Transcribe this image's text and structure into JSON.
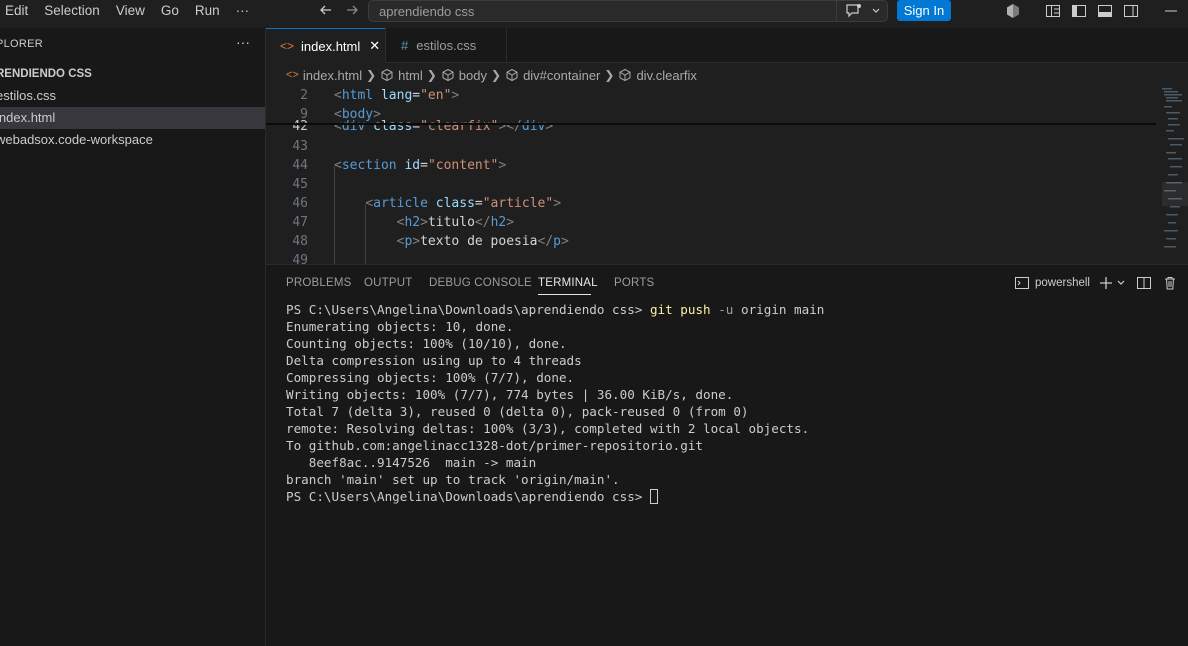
{
  "menu": [
    "Edit",
    "Selection",
    "View",
    "Go",
    "Run",
    "···"
  ],
  "search": {
    "text": "aprendiendo css"
  },
  "signin_label": "Sign In",
  "explorer": {
    "header": "PLORER",
    "more": "···",
    "folder": "RENDIENDO CSS",
    "files": [
      {
        "name": "estilos.css",
        "active": false
      },
      {
        "name": "index.html",
        "active": true
      },
      {
        "name": "webadsox.code-workspace",
        "active": false
      }
    ]
  },
  "tabs": [
    {
      "label": "index.html",
      "icon": "html-brackets-icon",
      "active": true,
      "close": "✕"
    },
    {
      "label": "estilos.css",
      "icon": "hash-icon",
      "active": false
    }
  ],
  "breadcrumb": [
    "index.html",
    "html",
    "body",
    "div#container",
    "div.clearfix"
  ],
  "editor": {
    "lines": [
      {
        "n": "2",
        "code": "<html lang=\"en\">"
      },
      {
        "n": "9",
        "code": "<body>"
      },
      {
        "n": "42",
        "code": "<div class=\"clearfix\"></div>"
      },
      {
        "n": "43",
        "code": ""
      },
      {
        "n": "44",
        "code": "<section id=\"content\">"
      },
      {
        "n": "45",
        "code": ""
      },
      {
        "n": "46",
        "code": "    <article class=\"article\">"
      },
      {
        "n": "47",
        "code": "        <h2>titulo</h2>"
      },
      {
        "n": "48",
        "code": "        <p>texto de poesia</p>"
      },
      {
        "n": "49",
        "code": ""
      }
    ]
  },
  "panel": {
    "tabs": [
      "PROBLEMS",
      "OUTPUT",
      "DEBUG CONSOLE",
      "TERMINAL",
      "PORTS"
    ],
    "active_tab": "TERMINAL",
    "shell": "powershell",
    "terminal": {
      "prompt": "PS C:\\Users\\Angelina\\Downloads\\aprendiendo css> ",
      "command": "git push",
      "flag": "-u",
      "args": "origin main",
      "output": [
        "Enumerating objects: 10, done.",
        "Counting objects: 100% (10/10), done.",
        "Delta compression using up to 4 threads",
        "Compressing objects: 100% (7/7), done.",
        "Writing objects: 100% (7/7), 774 bytes | 36.00 KiB/s, done.",
        "Total 7 (delta 3), reused 0 (delta 0), pack-reused 0 (from 0)",
        "remote: Resolving deltas: 100% (3/3), completed with 2 local objects.",
        "To github.com:angelinacc1328-dot/primer-repositorio.git",
        "   8eef8ac..9147526  main -> main",
        "branch 'main' set up to track 'origin/main'."
      ],
      "final_prompt": "PS C:\\Users\\Angelina\\Downloads\\aprendiendo css> "
    }
  }
}
